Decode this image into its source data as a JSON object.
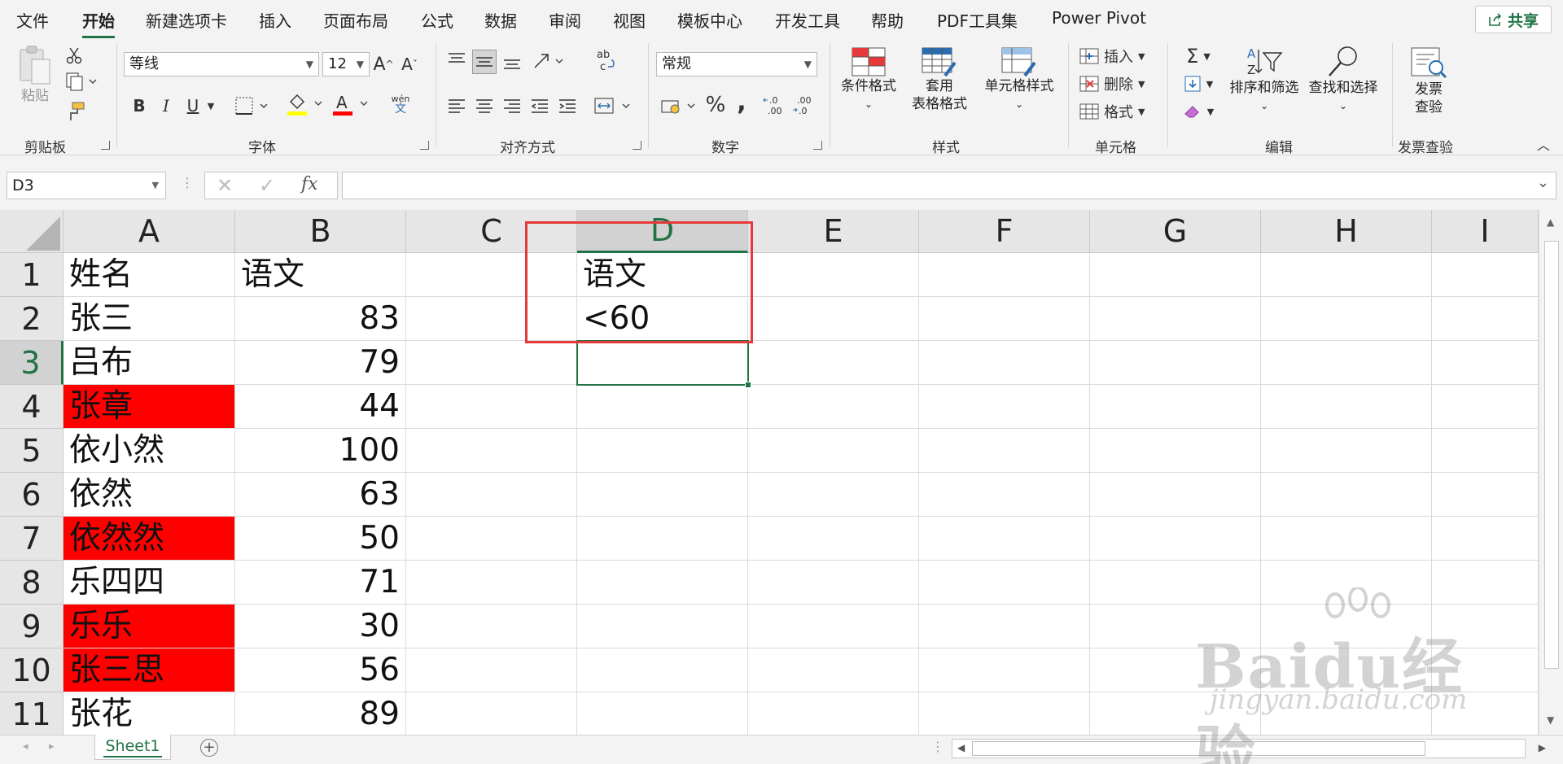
{
  "menu": {
    "tabs": [
      "文件",
      "开始",
      "新建选项卡",
      "插入",
      "页面布局",
      "公式",
      "数据",
      "审阅",
      "视图",
      "模板中心",
      "开发工具",
      "帮助",
      "PDF工具集",
      "Power Pivot"
    ],
    "active_tab": "开始",
    "share_label": "共享"
  },
  "ribbon": {
    "clipboard": {
      "paste_label": "粘贴",
      "group_label": "剪贴板"
    },
    "font": {
      "font_name": "等线",
      "font_size": "12",
      "group_label": "字体",
      "bold": "B",
      "italic": "I",
      "underline": "U",
      "phonetic_top": "wén",
      "phonetic_bottom": "文"
    },
    "alignment": {
      "group_label": "对齐方式"
    },
    "number": {
      "format": "常规",
      "percent": "%",
      "comma": ",",
      "group_label": "数字"
    },
    "styles": {
      "conditional_format": "条件格式",
      "table_format_1": "套用",
      "table_format_2": "表格格式",
      "cell_styles": "单元格样式",
      "group_label": "样式"
    },
    "cells": {
      "insert": "插入",
      "delete": "删除",
      "format": "格式",
      "group_label": "单元格"
    },
    "editing": {
      "sort_filter": "排序和筛选",
      "find_select": "查找和选择",
      "group_label": "编辑"
    },
    "invoice": {
      "check_1": "发票",
      "check_2": "查验",
      "group_label": "发票查验"
    }
  },
  "formula_bar": {
    "name_box": "D3",
    "fx": "fx",
    "formula": ""
  },
  "columns": [
    "A",
    "B",
    "C",
    "D",
    "E",
    "F",
    "G",
    "H",
    "I"
  ],
  "selected_column": "D",
  "selected_row": "3",
  "rows": [
    {
      "num": "1",
      "a": "姓名",
      "b": "语文",
      "d": "语文",
      "red": false
    },
    {
      "num": "2",
      "a": "张三",
      "b": "83",
      "d": "<60",
      "red": false
    },
    {
      "num": "3",
      "a": "吕布",
      "b": "79",
      "d": "",
      "red": false
    },
    {
      "num": "4",
      "a": "张章",
      "b": "44",
      "d": "",
      "red": true
    },
    {
      "num": "5",
      "a": "依小然",
      "b": "100",
      "d": "",
      "red": false
    },
    {
      "num": "6",
      "a": "依然",
      "b": "63",
      "d": "",
      "red": false
    },
    {
      "num": "7",
      "a": "依然然",
      "b": "50",
      "d": "",
      "red": true
    },
    {
      "num": "8",
      "a": "乐四四",
      "b": "71",
      "d": "",
      "red": false
    },
    {
      "num": "9",
      "a": "乐乐",
      "b": "30",
      "d": "",
      "red": true
    },
    {
      "num": "10",
      "a": "张三思",
      "b": "56",
      "d": "",
      "red": true
    },
    {
      "num": "11",
      "a": "张花",
      "b": "89",
      "d": "",
      "red": false
    }
  ],
  "sheet_tab": "Sheet1",
  "watermark": {
    "brand": "Baidu经验",
    "url": "jingyan.baidu.com"
  },
  "colors": {
    "accent": "#217346",
    "highlight_fill": "#ff0000",
    "annotation_box": "#e63939"
  }
}
